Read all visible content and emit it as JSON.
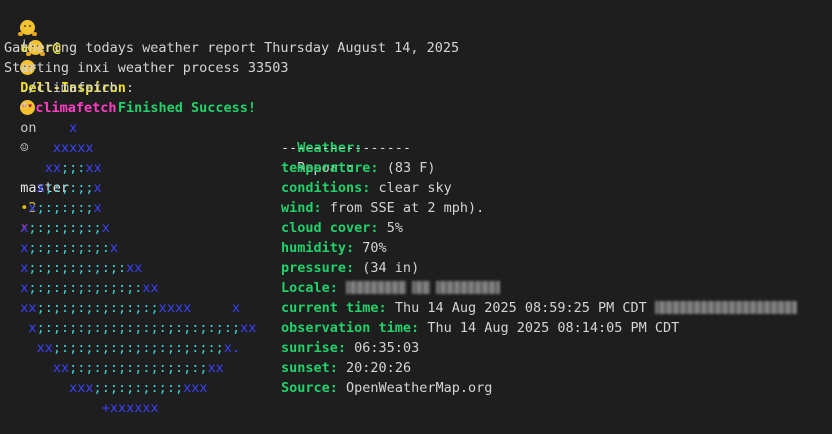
{
  "prompt": {
    "user": "user@",
    "host": "Dell-Inspiron",
    "separator": ":",
    "dir": "climafetch",
    "on": "on",
    "vcs_icon": "☺",
    "branch": "master",
    "dirty": "•2",
    "status_mark": "✗",
    "line2_prefix": "└",
    "arrow": "->",
    "command": "./climafetch"
  },
  "output": {
    "line1": "Gathering todays weather report Thursday August 14, 2025",
    "line2": "Starting inxi weather process 33503",
    "star": "*",
    "success": "Finished Success!"
  },
  "art_lines": [
    "        x",
    "      xxxxx",
    "     xx;;:xx",
    "    x;:;:;;x",
    "   x;:;:;:;x",
    "  x;:;:;:;:;x",
    "  x;:;:;:;:;:x",
    "  x;:;:;:;:;:;:xx",
    "  x;:;:;:;:;:;:;:xx",
    "  xx;:;:;:;:;:;:;:;xxxx     x",
    "   x;:;:;:;:;:;:;:;:;:;:;:;:;xx",
    "    xx;:;:;:;:;:;:;:;:;:;:;x.",
    "      xx;:;:;:;:;:;:;:;:;xx",
    "        xxx;:;:;:;:;:;xxx",
    "            +xxxxxx"
  ],
  "weather": {
    "header_label": "Weather:",
    "header_value": "Report:",
    "divider": "----------------",
    "rows": [
      {
        "label": "temperature:",
        "value": "(83 F)"
      },
      {
        "label": "conditions:",
        "value": "clear sky"
      },
      {
        "label": "wind:",
        "value": "from SSE at 2 mph)."
      },
      {
        "label": "cloud cover:",
        "value": "5%"
      },
      {
        "label": "humidity:",
        "value": "70%"
      },
      {
        "label": "pressure:",
        "value": "(34 in)"
      },
      {
        "label": "Locale:",
        "value": ""
      },
      {
        "label": "current time:",
        "value": "Thu 14 Aug 2025 08:59:25 PM CDT"
      },
      {
        "label": "observation time:",
        "value": "Thu 14 Aug 2025 08:14:05 PM CDT"
      },
      {
        "label": "sunrise:",
        "value": "06:35:03"
      },
      {
        "label": "sunset:",
        "value": "20:20:26"
      },
      {
        "label": "Source:",
        "value": "OpenWeatherMap.org"
      }
    ]
  },
  "colors": {
    "background": "#1e1e1e",
    "prompt_user": "#f0e020",
    "prompt_dir": "#ff3ec6",
    "label_green": "#21d16a",
    "art_blue": "#3a42ff",
    "art_cyan": "#34d7d7"
  },
  "icons": [
    "hugging-face-emoji-icon",
    "party-face-emoji-icon",
    "heart-eyes-emoji-icon"
  ]
}
